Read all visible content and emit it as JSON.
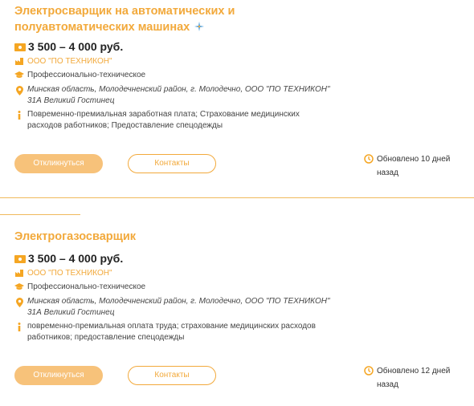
{
  "vacancies": [
    {
      "title": "Электросварщик на автоматических и полуавтоматических машинах",
      "salary": "3 500 – 4 000 руб.",
      "company": "ООО \"ПО ТЕХНИКОН\"",
      "education": "Профессионально-техническое",
      "location": "Минская область, Молодечненский район, г. Молодечно, ООО \"ПО ТЕХНИКОН\" 31А Великий Гостинец",
      "benefits": "Повременно-премиальная заработная плата; Страхование медицинских расходов работников; Предоставление спецодежды",
      "apply_label": "Откликнуться",
      "contacts_label": "Контакты",
      "updated": "Обновлено 10 дней назад"
    },
    {
      "title": "Электрогазосварщик",
      "salary": "3 500 – 4 000 руб.",
      "company": "ООО \"ПО ТЕХНИКОН\"",
      "education": "Профессионально-техническое",
      "location": "Минская область, Молодечненский район, г. Молодечно, ООО \"ПО ТЕХНИКОН\" 31А Великий Гостинец",
      "benefits": "повременно-премиальная оплата труда; страхование медицинских расходов работников; предоставление спецодежды",
      "apply_label": "Откликнуться",
      "contacts_label": "Контакты",
      "updated": "Обновлено 12 дней назад"
    }
  ],
  "colors": {
    "accent": "#f2a93b",
    "button_fill": "#f7c27a",
    "divider": "#f0b95c"
  },
  "icons": [
    "money-icon",
    "factory-icon",
    "graduation-cap-icon",
    "location-pin-icon",
    "info-icon",
    "clock-icon",
    "sparkle-icon"
  ]
}
